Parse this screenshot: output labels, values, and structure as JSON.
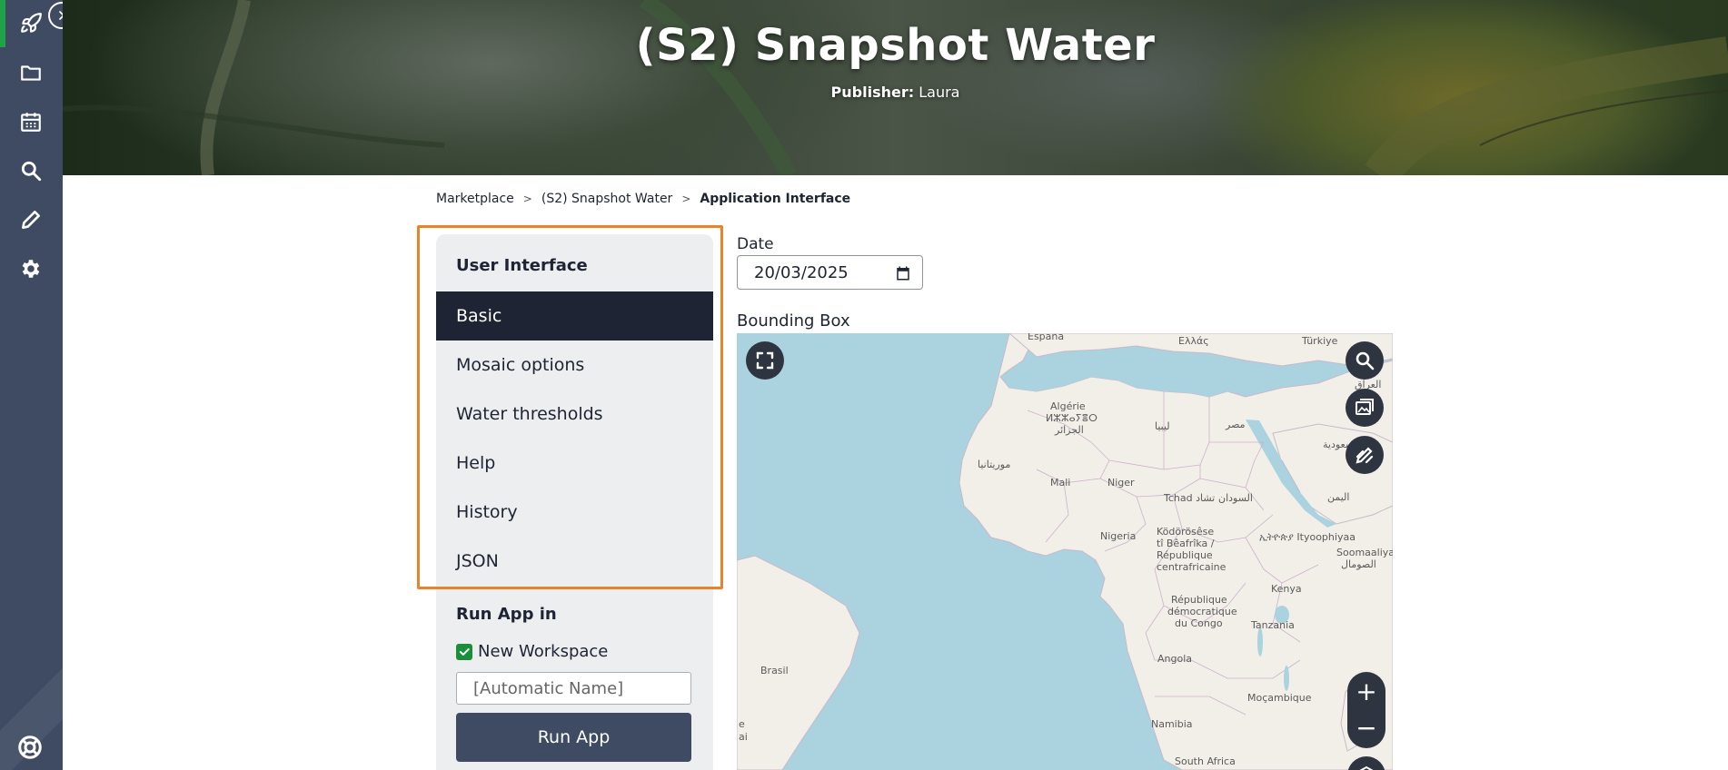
{
  "app": {
    "title": "(S2) Snapshot Water",
    "publisher_label": "Publisher:",
    "publisher_name": "Laura"
  },
  "rail": {
    "items": [
      {
        "icon": "rocket-icon"
      },
      {
        "icon": "folder-icon"
      },
      {
        "icon": "calendar-icon"
      },
      {
        "icon": "search-icon"
      },
      {
        "icon": "pencil-icon"
      },
      {
        "icon": "gear-icon"
      }
    ],
    "bottom_icon": "lifebuoy-icon",
    "toggle_icon": "chevron-right-icon"
  },
  "breadcrumb": {
    "items": [
      "Marketplace",
      "(S2) Snapshot Water",
      "Application Interface"
    ],
    "separator": ">"
  },
  "panel": {
    "heading": "User Interface",
    "items": [
      {
        "label": "Basic",
        "active": true
      },
      {
        "label": "Mosaic options",
        "active": false
      },
      {
        "label": "Water thresholds",
        "active": false
      },
      {
        "label": "Help",
        "active": false
      },
      {
        "label": "History",
        "active": false
      },
      {
        "label": "JSON",
        "active": false
      }
    ],
    "run_heading": "Run App in",
    "new_workspace_label": "New Workspace",
    "new_workspace_checked": true,
    "workspace_name_placeholder": "[Automatic Name]",
    "run_button": "Run App"
  },
  "form": {
    "date_label": "Date",
    "date_value": "20/03/2025",
    "bbox_label": "Bounding Box"
  },
  "map": {
    "labels": {
      "espana": "España",
      "ellada": "Ελλάς",
      "turkiye": "Türkiye",
      "iraq": "العراق",
      "algerie": "Algérie",
      "algerie_tif": "ⵍⵣⵣⴰⵢⴻⵔ",
      "algerie_ar": "الجزائر",
      "libya": "ليبيا",
      "egypt": "مصر",
      "saudi": "السعودية",
      "mauritania": "موريتانيا",
      "mali": "Mali",
      "niger": "Niger",
      "tchad": "Tchad تشاد",
      "sudan": "السودان",
      "yemen": "اليمن",
      "nigeria": "Nigeria",
      "car_1": "Ködörösêse",
      "car_2": "tî Bêafrîka /",
      "car_3": "République",
      "car_4": "centrafricaine",
      "ethiopia": "ኢትዮጵያ Ityoophiyaa",
      "somalia_1": "Soomaaliya",
      "somalia_2": "الصومال",
      "drc_1": "République",
      "drc_2": "démocratique",
      "drc_3": "du Congo",
      "kenya": "Kenya",
      "tanzania": "Tanzania",
      "brasil": "Brasil",
      "angola": "Angola",
      "mozambique": "Moçambique",
      "namibia": "Namibia",
      "south_africa": "South Africa",
      "edge_1": "e",
      "edge_2": "ai"
    },
    "controls": [
      "fullscreen-icon",
      "map-search-icon",
      "image-layer-icon",
      "draw-icon"
    ],
    "zoom_in": "+",
    "zoom_out": "−"
  },
  "colors": {
    "rail": "#3f4b63",
    "accent_green": "#1fa34a",
    "active_item": "#1e2433",
    "highlight": "#e8832a",
    "ocean": "#aad3df",
    "land": "#f2efe9"
  }
}
